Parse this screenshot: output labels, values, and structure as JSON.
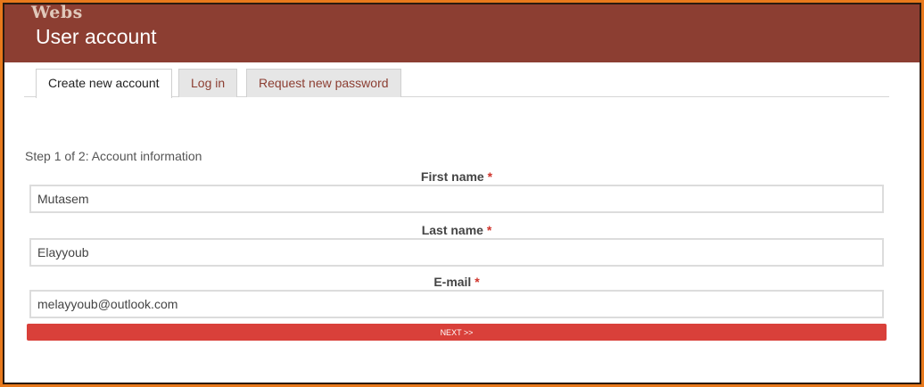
{
  "header": {
    "watermark": "Webs",
    "title": "User account"
  },
  "tabs": [
    {
      "label": "Create new account",
      "active": true
    },
    {
      "label": "Log in",
      "active": false
    },
    {
      "label": "Request new password",
      "active": false
    }
  ],
  "form": {
    "step": "Step 1 of 2: Account information",
    "required_mark": "*",
    "fields": [
      {
        "label": "First name",
        "value": "Mutasem"
      },
      {
        "label": "Last name",
        "value": "Elayyoub"
      },
      {
        "label": "E-mail",
        "value": "melayyoub@outlook.com"
      }
    ],
    "next_label": "NEXT >>"
  },
  "colors": {
    "header": "#8c3e32",
    "frame": "#e8791c",
    "button": "#d9403a",
    "required": "#d0342c"
  }
}
